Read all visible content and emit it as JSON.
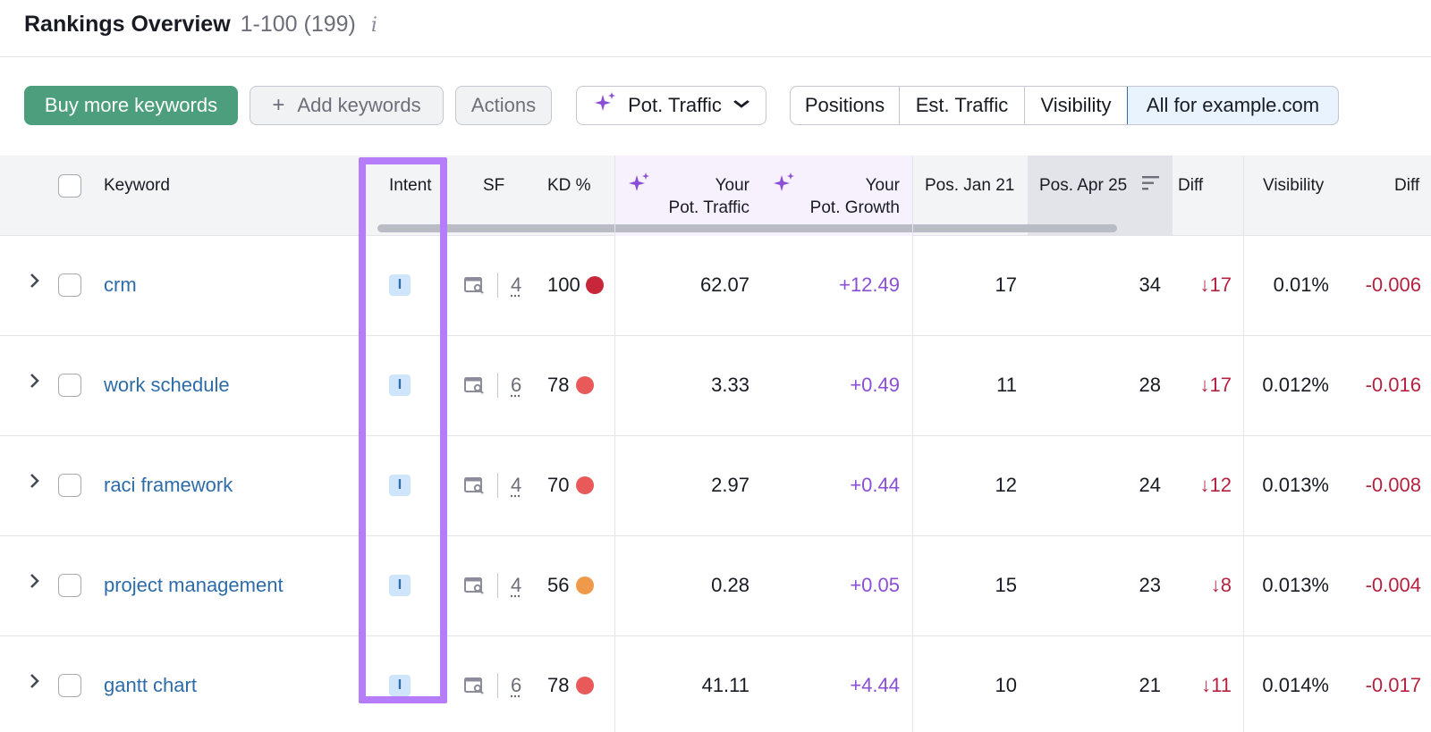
{
  "header": {
    "title": "Rankings Overview",
    "range": "1-100 (199)",
    "info_icon": "i"
  },
  "toolbar": {
    "buy_label": "Buy more keywords",
    "add_label": "Add keywords",
    "add_icon": "+",
    "actions_label": "Actions",
    "pot_traffic_label": "Pot. Traffic",
    "pot_traffic_icon": "sparkle-icon",
    "pot_traffic_chevron": "chevron-down-icon",
    "segments": [
      "Positions",
      "Est. Traffic",
      "Visibility",
      "All for example.com"
    ],
    "active_segment": "All for example.com"
  },
  "table": {
    "columns": {
      "keyword": "Keyword",
      "intent": "Intent",
      "sf": "SF",
      "kd": "KD %",
      "pot_traffic_1": "Your",
      "pot_traffic_2": "Pot. Traffic",
      "pot_growth_1": "Your",
      "pot_growth_2": "Pot. Growth",
      "pos_jan": "Pos. Jan 21",
      "pos_apr": "Pos. Apr 25",
      "diff": "Diff",
      "visibility": "Visibility",
      "vis_diff": "Diff"
    },
    "rows": [
      {
        "keyword": "crm",
        "intent": "I",
        "sf": "4",
        "kd": "100",
        "kd_color": "#c8263a",
        "pot_traffic": "62.07",
        "pot_growth": "+12.49",
        "pos_jan": "17",
        "pos_apr": "34",
        "diff": "↓17",
        "visibility": "0.01%",
        "vis_diff": "-0.006"
      },
      {
        "keyword": "work schedule",
        "intent": "I",
        "sf": "6",
        "kd": "78",
        "kd_color": "#e85a5a",
        "pot_traffic": "3.33",
        "pot_growth": "+0.49",
        "pos_jan": "11",
        "pos_apr": "28",
        "diff": "↓17",
        "visibility": "0.012%",
        "vis_diff": "-0.016"
      },
      {
        "keyword": "raci framework",
        "intent": "I",
        "sf": "4",
        "kd": "70",
        "kd_color": "#e85a5a",
        "pot_traffic": "2.97",
        "pot_growth": "+0.44",
        "pos_jan": "12",
        "pos_apr": "24",
        "diff": "↓12",
        "visibility": "0.013%",
        "vis_diff": "-0.008"
      },
      {
        "keyword": "project management",
        "intent": "I",
        "sf": "4",
        "kd": "56",
        "kd_color": "#ee9a4a",
        "pot_traffic": "0.28",
        "pot_growth": "+0.05",
        "pos_jan": "15",
        "pos_apr": "23",
        "diff": "↓8",
        "visibility": "0.013%",
        "vis_diff": "-0.004"
      },
      {
        "keyword": "gantt chart",
        "intent": "I",
        "sf": "6",
        "kd": "78",
        "kd_color": "#e85a5a",
        "pot_traffic": "41.11",
        "pot_growth": "+4.44",
        "pos_jan": "10",
        "pos_apr": "21",
        "diff": "↓11",
        "visibility": "0.014%",
        "vis_diff": "-0.017"
      }
    ]
  },
  "colors": {
    "accent_green": "#4d9e7c",
    "link_blue": "#2d6ca8",
    "purple": "#8a4fd6",
    "highlight": "#b67dfa",
    "negative_red": "#b5213e"
  }
}
